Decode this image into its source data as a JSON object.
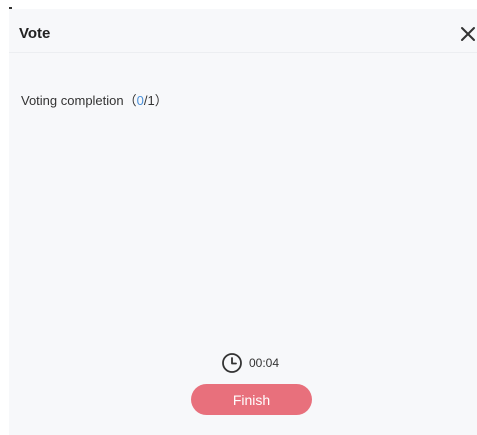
{
  "dialog": {
    "title": "Vote"
  },
  "completion": {
    "label": "Voting completion",
    "open_paren": "（",
    "done": "0",
    "separator": "/",
    "total": "1",
    "close_paren": "）"
  },
  "timer": {
    "icon": "clock-icon",
    "value": "00:04"
  },
  "actions": {
    "finish_label": "Finish"
  },
  "icons": {
    "close": "close-icon"
  },
  "colors": {
    "accent_button": "#e8707c",
    "count_highlight": "#4a90d9",
    "panel_background": "#f7f8fa"
  }
}
